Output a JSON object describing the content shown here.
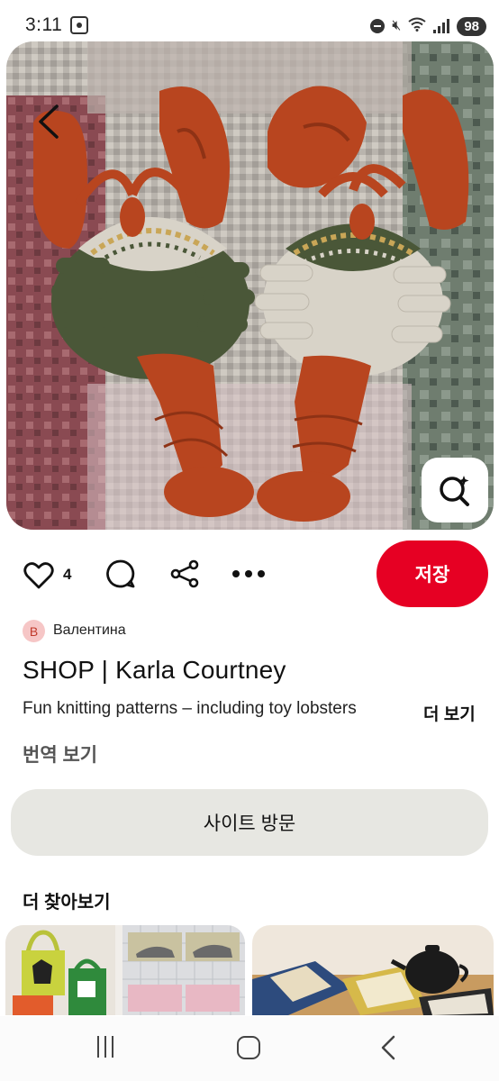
{
  "status_bar": {
    "time": "3:11",
    "battery": "98",
    "icons": [
      "screenshot-icon",
      "dnd-icon",
      "mute-icon",
      "wifi-icon",
      "signal-icon"
    ]
  },
  "pin": {
    "image_alt": "Knitted lobster toys wearing fair isle sweaters on a patterned rug",
    "likes": "4",
    "save_label": "저장",
    "author": {
      "initial": "B",
      "name": "Валентина"
    },
    "title": "SHOP | Karla Courtney",
    "description": "Fun knitting patterns – including toy lobsters",
    "more_label": "더 보기",
    "translate_label": "번역 보기",
    "visit_label": "사이트 방문"
  },
  "explore": {
    "title": "더 찾아보기"
  },
  "colors": {
    "save_red": "#e60023",
    "visit_bg": "#e7e7e2",
    "lobster_orange": "#b8451f",
    "sweater_green": "#4a5738",
    "sweater_cream": "#d8d3c8"
  },
  "nav": [
    "recent-apps-icon",
    "home-icon",
    "back-icon"
  ]
}
